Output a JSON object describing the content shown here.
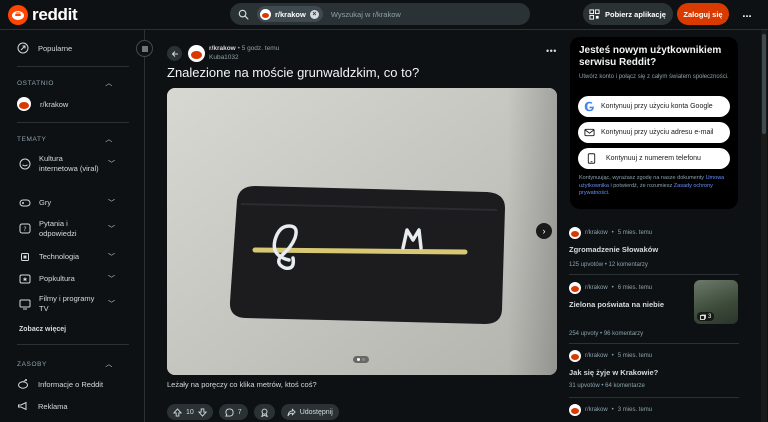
{
  "header": {
    "logo_text": "reddit",
    "search_chip": "r/krakow",
    "search_placeholder": "Wyszukaj w r/krakow",
    "get_app_label": "Pobierz aplikację",
    "login_label": "Zaloguj się",
    "more_label": "..."
  },
  "sidebar": {
    "popular_label": "Popularne",
    "recent_heading": "OSTATNIO",
    "recent_item": "r/krakow",
    "topics_heading": "TEMATY",
    "topics": [
      {
        "label": "Kultura internetowa (viral)",
        "icon": "smile-icon"
      },
      {
        "label": "Gry",
        "icon": "gamepad-icon"
      },
      {
        "label": "Pytania i odpowiedzi",
        "icon": "question-icon"
      },
      {
        "label": "Technologia",
        "icon": "chip-icon"
      },
      {
        "label": "Popkultura",
        "icon": "star-icon"
      },
      {
        "label": "Filmy i programy TV",
        "icon": "film-icon"
      }
    ],
    "see_more": "Zobacz więcej",
    "resources_heading": "ZASOBY",
    "about_label": "Informacje o Reddit",
    "ads_label": "Reklama"
  },
  "post": {
    "subreddit": "r/krakow",
    "age": "5 godz. temu",
    "author": "Kuba1032",
    "title": "Znalezione na moście grunwaldzkim, co to?",
    "caption": "Leżały na poręczy co klika metrów, ktoś coś?",
    "score": "10",
    "comments": "7",
    "share_label": "Udostępnij",
    "image_count": 2,
    "image_index": 1
  },
  "signup": {
    "title": "Jesteś nowym użytkownikiem serwisu Reddit?",
    "subtitle": "Utwórz konto i połącz się z całym światem społeczności.",
    "google_label": "Kontynuuj przy użyciu konta Google",
    "email_label": "Kontynuuj przy użyciu adresu e-mail",
    "phone_label": "Kontynuuj z numerem telefonu",
    "legal_prefix": "Kontynuując, wyrażasz zgodę na nasze dokumenty ",
    "legal_terms": "Umowa użytkownika",
    "legal_mid": " i potwierdź, że rozumiesz ",
    "legal_privacy": "Zasady ochrony prywatności",
    "legal_suffix": "."
  },
  "related": [
    {
      "sub": "r/krakow",
      "age": "5 mies. temu",
      "title": "Zgromadzenie Słowaków",
      "upvotes": "125 upvotów",
      "comments": "12 komentarzy"
    },
    {
      "sub": "r/krakow",
      "age": "6 mies. temu",
      "title": "Zielona poświata na niebie",
      "upvotes": "254 upvoty",
      "comments": "96 komentarzy",
      "thumb_count": "3"
    },
    {
      "sub": "r/krakow",
      "age": "5 mies. temu",
      "title": "Jak się żyje w Krakowie?",
      "upvotes": "31 upvotów",
      "comments": "64 komentarze"
    },
    {
      "sub": "r/krakow",
      "age": "3 mies. temu",
      "title": "",
      "upvotes": "",
      "comments": ""
    }
  ],
  "colors": {
    "brand": "#ff4500",
    "login": "#d93a00",
    "link": "#648efc",
    "background": "#0e1113"
  }
}
